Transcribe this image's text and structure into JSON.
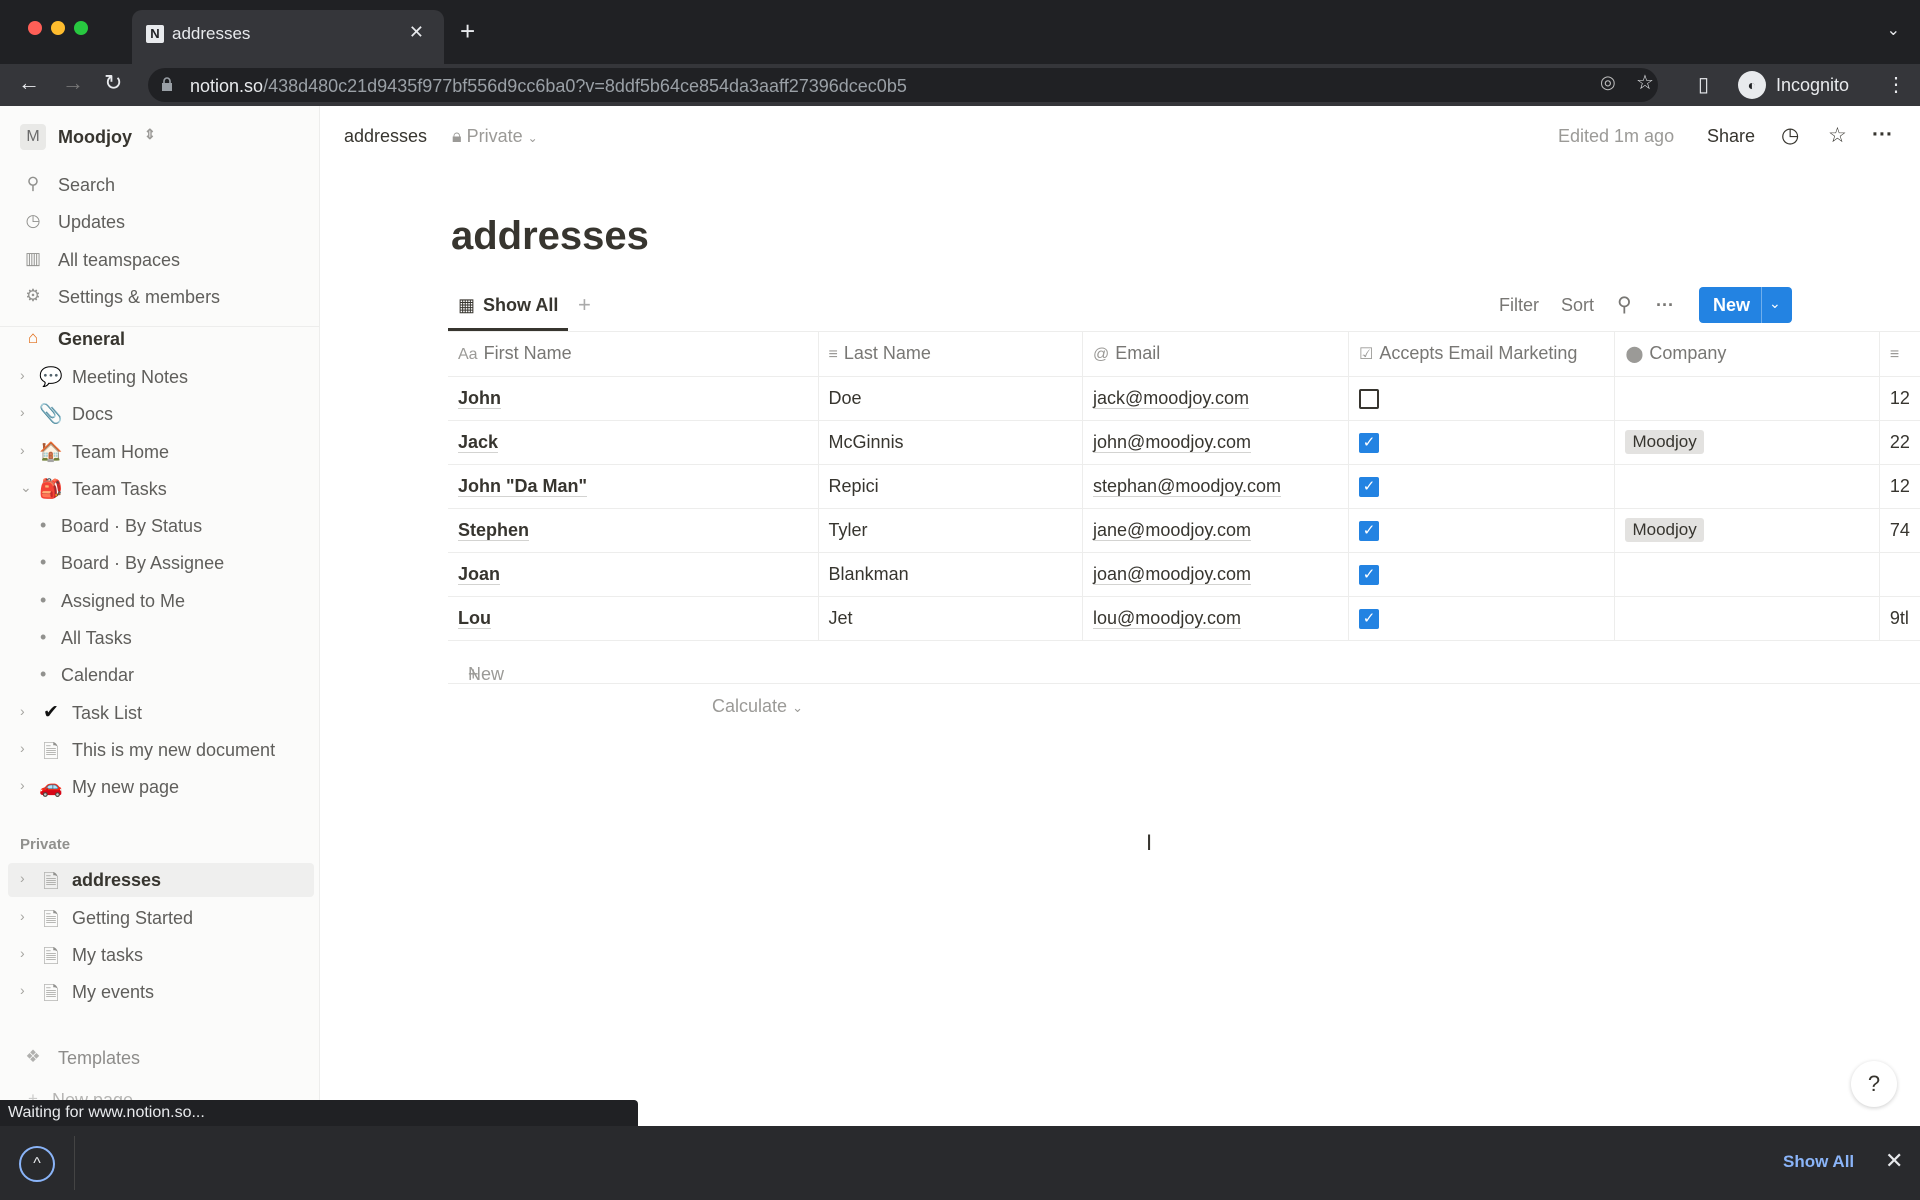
{
  "browser": {
    "tab_title": "addresses",
    "tab_icon": "N",
    "url_domain": "notion.so",
    "url_path": "/438d480c21d9435f977bf556d9cc6ba0?v=8ddf5b64ce854da3aaff27396dcec0b5",
    "profile_label": "Incognito",
    "status_text": "Waiting for www.notion.so..."
  },
  "sidebar": {
    "workspace_initial": "M",
    "workspace_name": "Moodjoy",
    "top_items": [
      {
        "label": "Search",
        "icon": "search-icon"
      },
      {
        "label": "Updates",
        "icon": "clock-icon"
      },
      {
        "label": "All teamspaces",
        "icon": "building-icon"
      },
      {
        "label": "Settings & members",
        "icon": "gear-icon"
      }
    ],
    "teamspace": {
      "label": "General",
      "icon": "🏠"
    },
    "pages": [
      {
        "label": "Meeting Notes",
        "icon": "💬"
      },
      {
        "label": "Docs",
        "icon": "📎"
      },
      {
        "label": "Team Home",
        "icon": "🏠"
      },
      {
        "label": "Team Tasks",
        "icon": "🎒"
      }
    ],
    "subpages": [
      "Board · By Status",
      "Board · By Assignee",
      "Assigned to Me",
      "All Tasks",
      "Calendar"
    ],
    "pages2": [
      {
        "label": "Task List",
        "icon": "✔"
      },
      {
        "label": "This is my new document",
        "icon": "🗎"
      },
      {
        "label": "My new page",
        "icon": "🚗"
      }
    ],
    "private_label": "Private",
    "private_pages": [
      {
        "label": "addresses",
        "icon": "🗎"
      },
      {
        "label": "Getting Started",
        "icon": "🗎"
      },
      {
        "label": "My tasks",
        "icon": "🗎"
      },
      {
        "label": "My events",
        "icon": "🗎"
      }
    ],
    "templates_label": "Templates",
    "new_page_label": "New page"
  },
  "topbar": {
    "breadcrumb": "addresses",
    "privacy": "Private",
    "edited": "Edited 1m ago",
    "share": "Share"
  },
  "page": {
    "title": "addresses",
    "view_tab": "Show All",
    "actions": {
      "filter": "Filter",
      "sort": "Sort",
      "new": "New"
    },
    "columns": [
      "First Name",
      "Last Name",
      "Email",
      "Accepts Email Marketing",
      "Company",
      ""
    ],
    "rows": [
      {
        "first": "John",
        "last": "Doe",
        "email": "jack@moodjoy.com",
        "accepts": false,
        "company": "",
        "extra": "12"
      },
      {
        "first": "Jack",
        "last": "McGinnis",
        "email": "john@moodjoy.com",
        "accepts": true,
        "company": "Moodjoy",
        "extra": "22"
      },
      {
        "first": "John \"Da Man\"",
        "last": "Repici",
        "email": "stephan@moodjoy.com",
        "accepts": true,
        "company": "",
        "extra": "12"
      },
      {
        "first": "Stephen",
        "last": "Tyler",
        "email": "jane@moodjoy.com",
        "accepts": true,
        "company": "Moodjoy",
        "extra": "74"
      },
      {
        "first": "Joan",
        "last": "Blankman",
        "email": "joan@moodjoy.com",
        "accepts": true,
        "company": "",
        "extra": ""
      },
      {
        "first": "Lou",
        "last": "Jet",
        "email": "lou@moodjoy.com",
        "accepts": true,
        "company": "",
        "extra": "9tl"
      }
    ],
    "new_row": "New",
    "calculate": "Calculate"
  },
  "downloads": {
    "show_all": "Show All"
  },
  "colors": {
    "accent": "#2383e2"
  }
}
